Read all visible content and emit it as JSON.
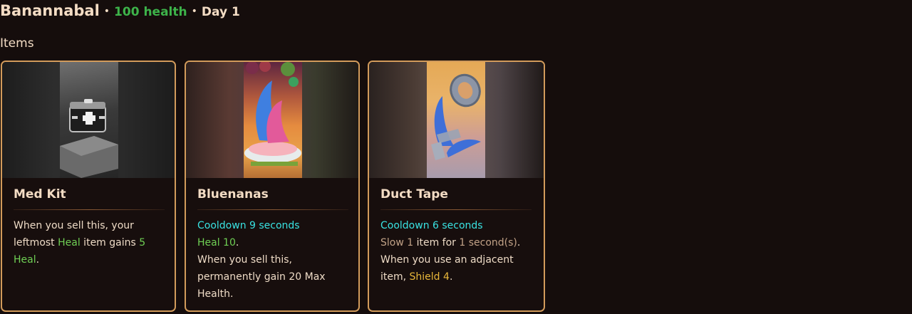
{
  "header": {
    "name": "Banannabal",
    "separator": "•",
    "health": "100 health",
    "day": "Day 1"
  },
  "section_title": "Items",
  "colors": {
    "heal": "#6fcf54",
    "cooldown": "#39e2e2",
    "slow": "#c2a287",
    "shield": "#e8b73a",
    "card_border": "#d29b5b",
    "health_header": "#3db34a"
  },
  "items": [
    {
      "name": "Med Kit",
      "image": "med-kit-image",
      "desc": {
        "p1": "When you sell this, your leftmost ",
        "heal_word": "Heal",
        "p2": " item gains ",
        "heal_amount": "5 Heal",
        "p3": "."
      }
    },
    {
      "name": "Bluenanas",
      "image": "bluenanas-image",
      "desc": {
        "cooldown": "Cooldown 9 seconds",
        "heal": "Heal 10",
        "heal_end": ".",
        "line3": "When you sell this, permanently gain 20 Max Health."
      }
    },
    {
      "name": "Duct Tape",
      "image": "duct-tape-image",
      "desc": {
        "cooldown": "Cooldown 6 seconds",
        "slow": "Slow 1",
        "mid": " item for ",
        "duration": "1 second(s)",
        "end": ".",
        "line3": "When you use an adjacent item, ",
        "shield": "Shield 4",
        "line3_end": "."
      }
    }
  ]
}
